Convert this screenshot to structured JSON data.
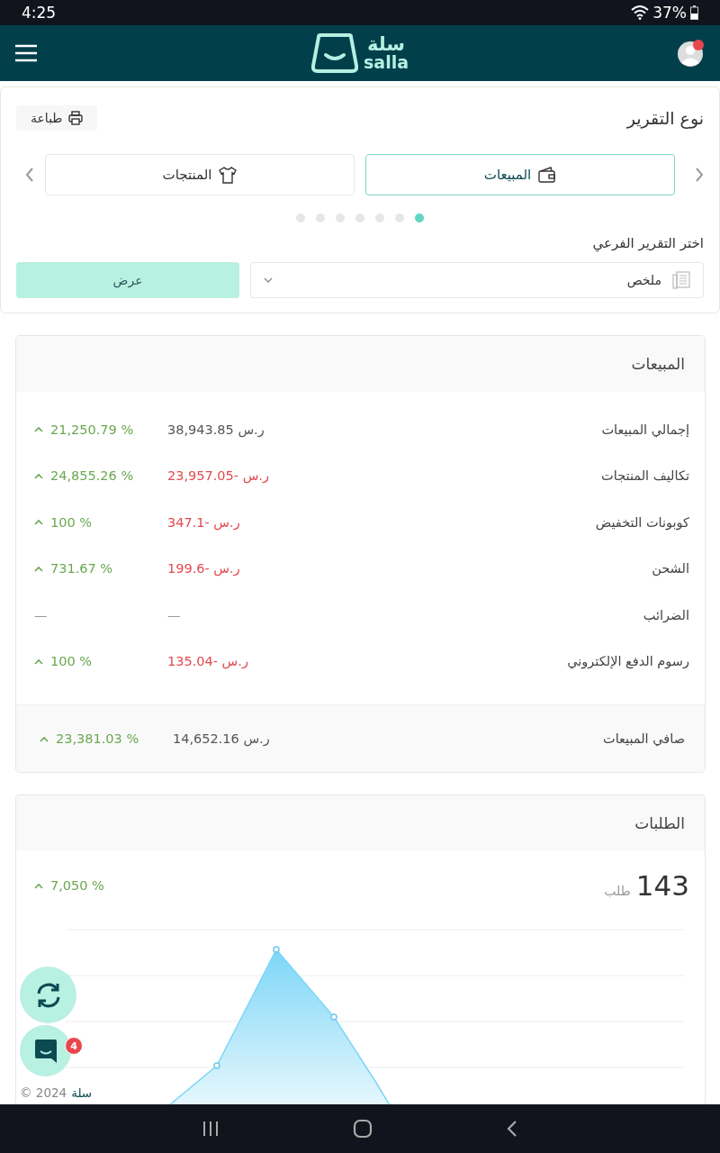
{
  "status_bar": {
    "time": "4:25",
    "battery": "37%"
  },
  "header": {
    "logo_arabic": "سلة",
    "logo_latin": "salla"
  },
  "report_type": {
    "title": "نوع التقرير",
    "print_button": "طباعة",
    "tabs": [
      {
        "label": "المبيعات",
        "selected": true
      },
      {
        "label": "المنتجات",
        "selected": false
      }
    ],
    "pages": [
      {
        "selected": true
      },
      {
        "selected": false
      },
      {
        "selected": false
      },
      {
        "selected": false
      },
      {
        "selected": false
      },
      {
        "selected": false
      },
      {
        "selected": false
      }
    ],
    "subreport_label": "اختر التقرير الفرعي",
    "subreport_value": "ملخص",
    "show_button": "عرض"
  },
  "sales": {
    "title": "المبيعات",
    "rows": [
      {
        "label": "إجمالي المبيعات",
        "amount": "ر.س 38,943.85",
        "negative": false,
        "change": "21,250.79 %",
        "rising": true
      },
      {
        "label": "تكاليف المنتجات",
        "amount": "ر.س -23,957.05",
        "negative": true,
        "change": "24,855.26 %",
        "rising": true
      },
      {
        "label": "كوبونات التخفيض",
        "amount": "ر.س -347.1",
        "negative": true,
        "change": "100 %",
        "rising": true
      },
      {
        "label": "الشحن",
        "amount": "ر.س -199.6",
        "negative": true,
        "change": "731.67 %",
        "rising": true
      },
      {
        "label": "الضرائب",
        "amount": "—",
        "negative": false,
        "change": "—",
        "rising": false
      },
      {
        "label": "رسوم الدفع الإلكتروني",
        "amount": "ر.س -135.04",
        "negative": true,
        "change": "100 %",
        "rising": true
      }
    ],
    "total": {
      "label": "صافي المبيعات",
      "amount": "ر.س 14,652.16",
      "negative": false,
      "change": "23,381.03 %",
      "rising": true
    }
  },
  "orders": {
    "title": "الطلبات",
    "count": "143",
    "unit": "طلب",
    "change": "7,050 %",
    "rising": true
  },
  "chat_badge": "4",
  "footer": {
    "brand": "سلة",
    "copyright": "© 2024"
  }
}
